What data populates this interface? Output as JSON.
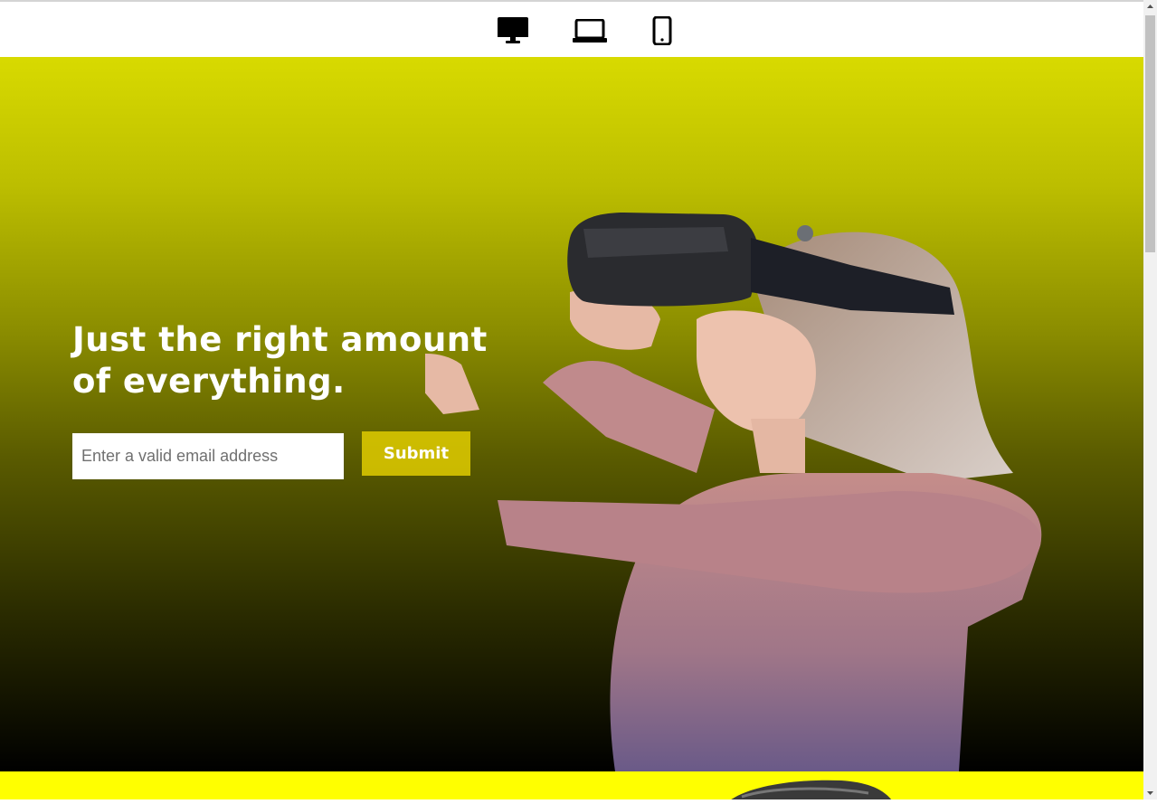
{
  "toolbar": {
    "icons": [
      "desktop-icon",
      "laptop-icon",
      "mobile-icon"
    ]
  },
  "hero": {
    "title_line1": "Just the right amount",
    "title_line2": "of everything.",
    "email_placeholder": "Enter a valid email address",
    "submit_label": "Submit",
    "gradient_top": "#d8da00",
    "gradient_bottom": "#000000"
  },
  "section2": {
    "background": "#ffff00"
  }
}
